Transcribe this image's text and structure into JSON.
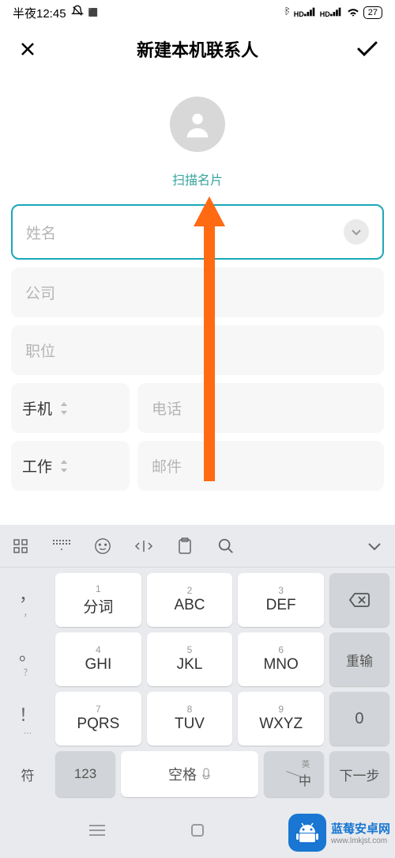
{
  "status": {
    "time": "半夜12:45",
    "battery": "27"
  },
  "header": {
    "title": "新建本机联系人"
  },
  "avatar": {
    "scan_card": "扫描名片"
  },
  "form": {
    "name_placeholder": "姓名",
    "company_placeholder": "公司",
    "position_placeholder": "职位",
    "phone_type": "手机",
    "phone_placeholder": "电话",
    "email_type": "工作",
    "email_placeholder": "邮件"
  },
  "keyboard": {
    "keys": [
      {
        "num": "1",
        "label": "分词"
      },
      {
        "num": "2",
        "label": "ABC"
      },
      {
        "num": "3",
        "label": "DEF"
      },
      {
        "num": "4",
        "label": "GHI"
      },
      {
        "num": "5",
        "label": "JKL"
      },
      {
        "num": "6",
        "label": "MNO"
      },
      {
        "num": "7",
        "label": "PQRS"
      },
      {
        "num": "8",
        "label": "TUV"
      },
      {
        "num": "9",
        "label": "WXYZ"
      }
    ],
    "side": {
      "comma": "，",
      "period": "。",
      "question": "？",
      "exclaim": "！",
      "retype": "重输",
      "zero": "0"
    },
    "bottom": {
      "symbol": "符",
      "num": "123",
      "space": "空格",
      "lang_en": "英",
      "lang_cn": "中",
      "next": "下一步"
    }
  },
  "watermark": {
    "title": "蓝莓安卓网",
    "url": "www.lmkjst.com"
  }
}
